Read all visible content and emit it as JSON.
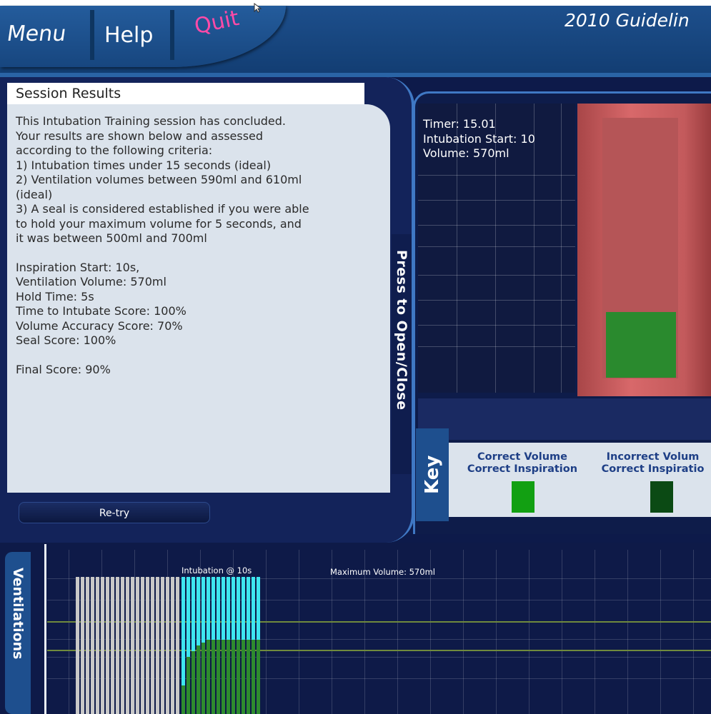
{
  "nav": {
    "menu": "Menu",
    "help": "Help",
    "quit": "Quit"
  },
  "header": {
    "guidelines": "2010 Guidelin"
  },
  "results": {
    "title": "Session Results",
    "intro": [
      "This Intubation Training session has concluded.",
      "Your results are shown below and assessed",
      "according to the following criteria:",
      "1) Intubation times under 15 seconds (ideal)",
      "2) Ventilation volumes between 590ml and 610ml",
      "(ideal)",
      "3) A seal is considered established if you were able",
      "to hold your maximum volume for 5 seconds, and",
      "it was between 500ml and 700ml"
    ],
    "stats": [
      "Inspiration Start: 10s,",
      "Ventilation Volume: 570ml",
      "Hold Time: 5s",
      "Time to Intubate Score: 100%",
      "Volume Accuracy Score: 70%",
      "Seal Score: 100%"
    ],
    "final": "Final Score: 90%",
    "retry": "Re-try",
    "toggle": "Press to Open/Close"
  },
  "monitor": {
    "timer": "Timer: 15.01",
    "intubation_start": "Intubation Start: 10",
    "volume": "Volume: 570ml",
    "volume_fill_fraction": 0.25
  },
  "key": {
    "tab": "Key",
    "items": [
      {
        "line1": "Correct Volume",
        "line2": "Correct Inspiration",
        "color": "#12a012"
      },
      {
        "line1": "Incorrect Volum",
        "line2": "Correct Inspiratio",
        "color": "#0b4a14"
      }
    ]
  },
  "ventilations": {
    "tab": "Ventilations",
    "intubation_annotation": "Intubation @ 10s",
    "max_volume_annotation": "Maximum Volume: 570ml",
    "colors": {
      "pre": "#c8c8c8",
      "cyan": "#3ee6f0",
      "green": "#2e8b2e"
    }
  }
}
